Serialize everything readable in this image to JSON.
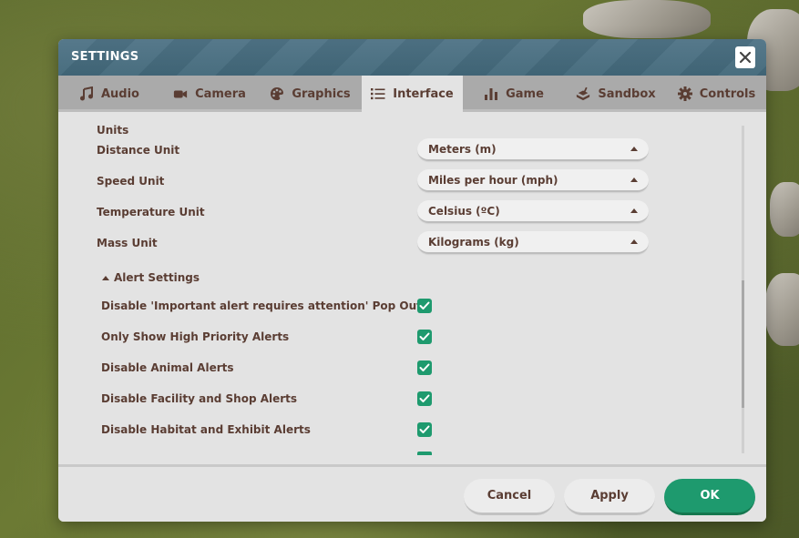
{
  "window": {
    "title": "SETTINGS"
  },
  "tabs": [
    {
      "label": "Audio",
      "icon": "music-icon"
    },
    {
      "label": "Camera",
      "icon": "camera-icon"
    },
    {
      "label": "Graphics",
      "icon": "palette-icon"
    },
    {
      "label": "Interface",
      "icon": "list-icon",
      "active": true
    },
    {
      "label": "Game",
      "icon": "bar-chart-icon"
    },
    {
      "label": "Sandbox",
      "icon": "sandbox-icon"
    },
    {
      "label": "Controls",
      "icon": "gear-icon"
    }
  ],
  "units": {
    "section_label": "Units",
    "rows": [
      {
        "label": "Distance Unit",
        "value": "Meters (m)"
      },
      {
        "label": "Speed Unit",
        "value": "Miles per hour (mph)"
      },
      {
        "label": "Temperature Unit",
        "value": "Celsius (ºC)"
      },
      {
        "label": "Mass Unit",
        "value": "Kilograms (kg)"
      }
    ]
  },
  "alerts": {
    "header": "Alert Settings",
    "items": [
      {
        "label": "Disable 'Important alert requires attention' Pop Out",
        "checked": true
      },
      {
        "label": "Only Show High Priority Alerts",
        "checked": true
      },
      {
        "label": "Disable Animal Alerts",
        "checked": true
      },
      {
        "label": "Disable Facility and Shop Alerts",
        "checked": true
      },
      {
        "label": "Disable Habitat and Exhibit Alerts",
        "checked": true
      }
    ]
  },
  "footer": {
    "cancel_label": "Cancel",
    "apply_label": "Apply",
    "ok_label": "OK"
  },
  "colors": {
    "accent": "#1e9a6e",
    "text": "#5a3d33",
    "titlebar": "#4a6f82"
  }
}
